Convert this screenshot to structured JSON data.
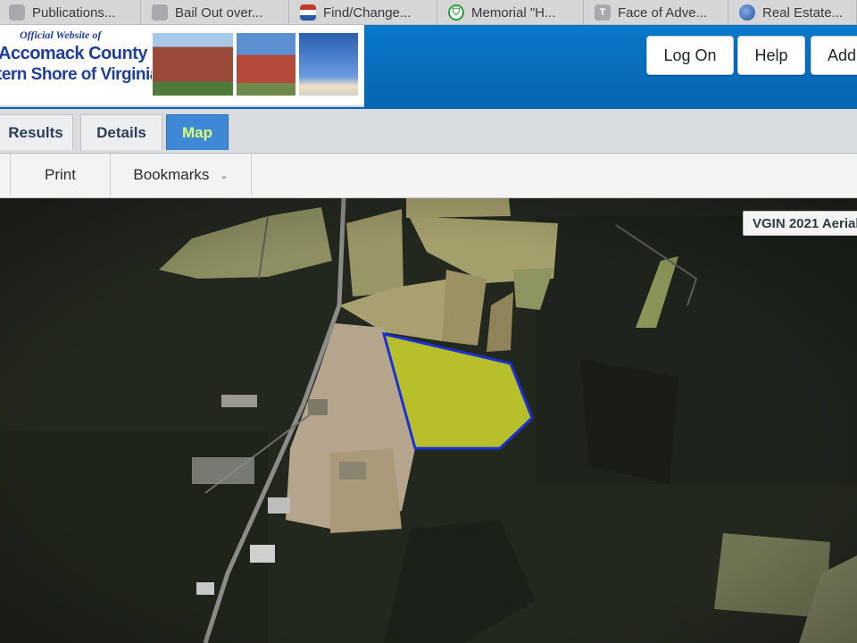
{
  "browser_tabs": [
    {
      "label": "Publications...",
      "icon": "document-icon"
    },
    {
      "label": "Bail Out over...",
      "icon": "document-icon"
    },
    {
      "label": "Find/Change...",
      "icon": "flag-icon"
    },
    {
      "label": "Memorial \"H...",
      "icon": "shield-icon"
    },
    {
      "label": "Face of Adve...",
      "icon": "letter-t-icon"
    },
    {
      "label": "Real Estate...",
      "icon": "globe-icon"
    }
  ],
  "header": {
    "logo_subtitle": "Official Website of",
    "logo_county": "Accomack County",
    "logo_shore": "tern Shore of Virginia",
    "buttons": {
      "log_on": "Log On",
      "help": "Help",
      "add": "Add"
    }
  },
  "tabs": {
    "results": "Results",
    "details": "Details",
    "map": "Map",
    "active": "Map"
  },
  "toolbar": {
    "print": "Print",
    "bookmarks": "Bookmarks"
  },
  "map": {
    "basemap_label": "VGIN 2021 Aerial"
  },
  "colors": {
    "header_blue": "#0a78c9",
    "parcel_fill": "#b7bf2a",
    "parcel_outline": "#1c2fd8",
    "active_tab": "#3f88d6"
  }
}
